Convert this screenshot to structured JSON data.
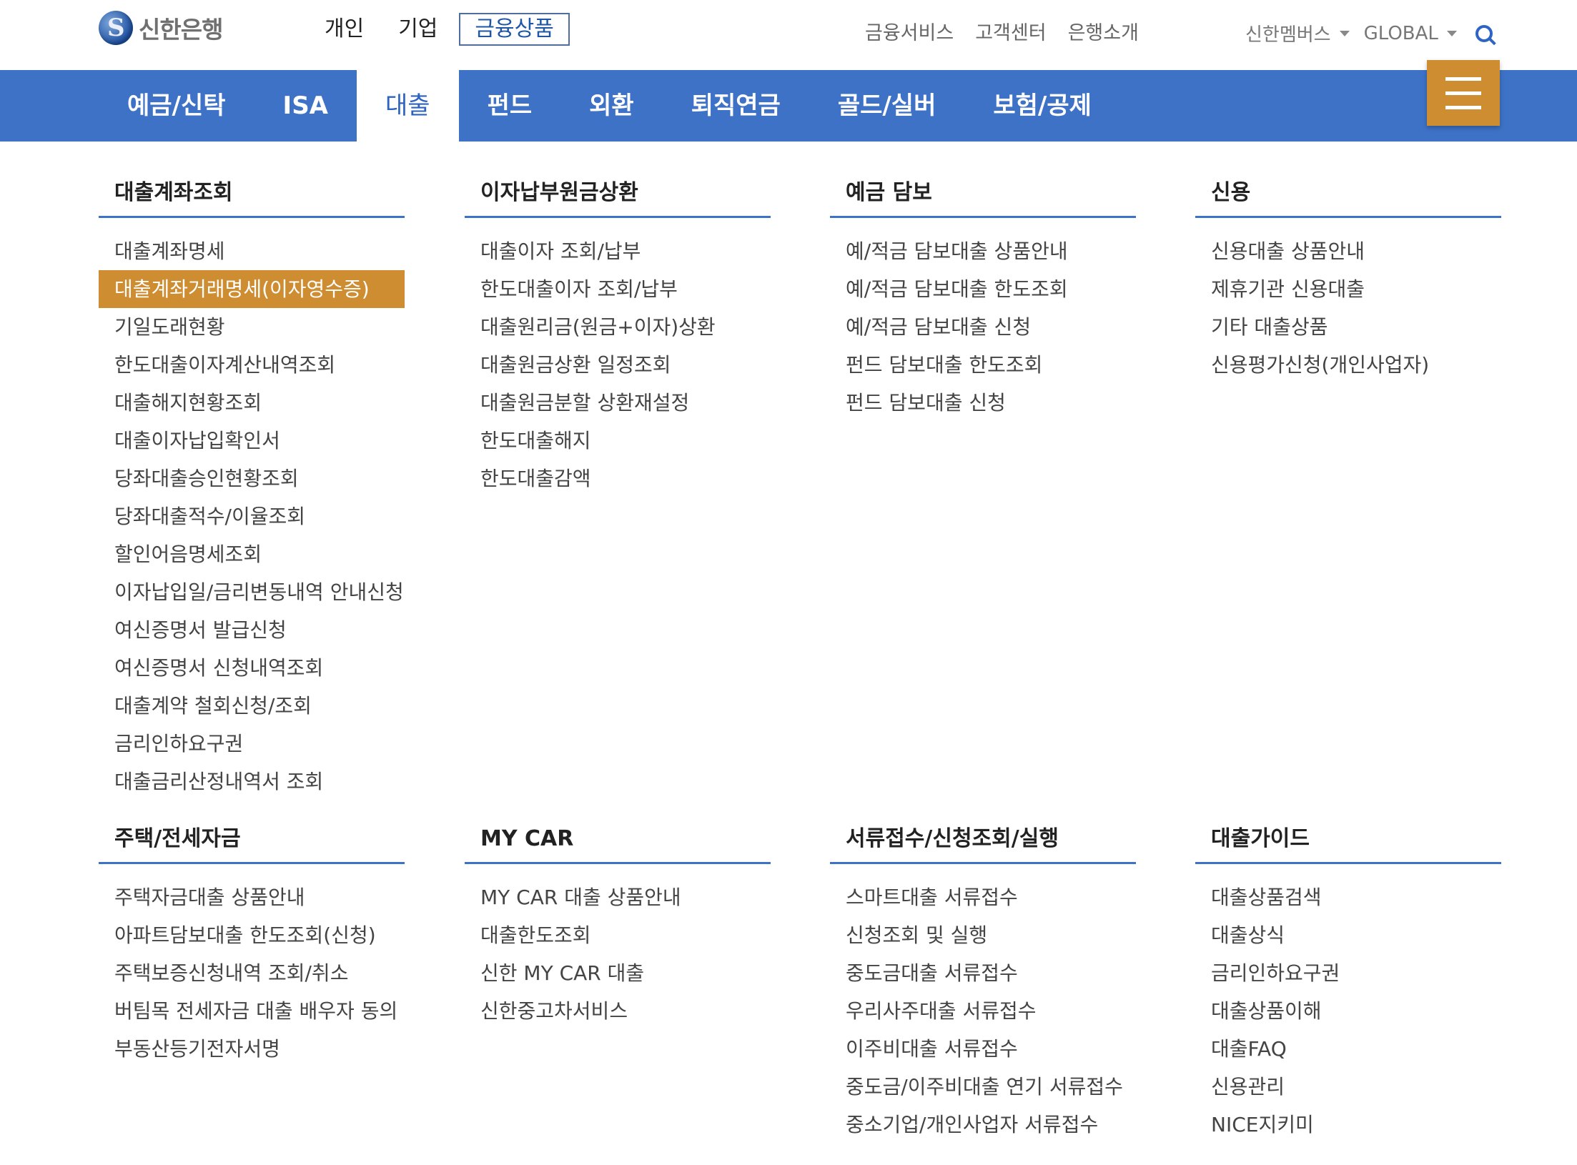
{
  "brand": {
    "name": "신한은행"
  },
  "segments": [
    {
      "label": "개인",
      "active": false
    },
    {
      "label": "기업",
      "active": false
    },
    {
      "label": "금융상품",
      "active": true
    }
  ],
  "utility_links": [
    "금융서비스",
    "고객센터",
    "은행소개"
  ],
  "right_dropdowns": {
    "members": "신한멤버스",
    "global": "GLOBAL"
  },
  "nav": {
    "items": [
      "예금/신탁",
      "ISA",
      "대출",
      "펀드",
      "외환",
      "퇴직연금",
      "골드/실버",
      "보험/공제"
    ],
    "active_index": 2
  },
  "menu": {
    "row1": [
      {
        "title": "대출계좌조회",
        "items": [
          "대출계좌명세",
          "대출계좌거래명세(이자영수증)",
          "기일도래현황",
          "한도대출이자계산내역조회",
          "대출해지현황조회",
          "대출이자납입확인서",
          "당좌대출승인현황조회",
          "당좌대출적수/이율조회",
          "할인어음명세조회",
          "이자납입일/금리변동내역 안내신청",
          "여신증명서 발급신청",
          "여신증명서 신청내역조회",
          "대출계약 철회신청/조회",
          "금리인하요구권",
          "대출금리산정내역서 조회"
        ],
        "highlight_index": 1
      },
      {
        "title": "이자납부원금상환",
        "items": [
          "대출이자 조회/납부",
          "한도대출이자 조회/납부",
          "대출원리금(원금+이자)상환",
          "대출원금상환 일정조회",
          "대출원금분할 상환재설정",
          "한도대출해지",
          "한도대출감액"
        ]
      },
      {
        "title": "예금 담보",
        "items": [
          "예/적금 담보대출 상품안내",
          "예/적금 담보대출 한도조회",
          "예/적금 담보대출 신청",
          "펀드 담보대출 한도조회",
          "펀드 담보대출 신청"
        ]
      },
      {
        "title": "신용",
        "items": [
          "신용대출 상품안내",
          "제휴기관 신용대출",
          "기타 대출상품",
          "신용평가신청(개인사업자)"
        ]
      }
    ],
    "row2": [
      {
        "title": "주택/전세자금",
        "items": [
          "주택자금대출 상품안내",
          "아파트담보대출 한도조회(신청)",
          "주택보증신청내역 조회/취소",
          "버팀목 전세자금 대출 배우자 동의",
          "부동산등기전자서명"
        ]
      },
      {
        "title": "MY CAR",
        "items": [
          "MY CAR 대출 상품안내",
          "대출한도조회",
          "신한 MY CAR 대출",
          "신한중고차서비스"
        ]
      },
      {
        "title": "서류접수/신청조회/실행",
        "items": [
          "스마트대출 서류접수",
          "신청조회 및 실행",
          "중도금대출 서류접수",
          "우리사주대출 서류접수",
          "이주비대출 서류접수",
          "중도금/이주비대출 연기 서류접수",
          "중소기업/개인사업자 서류접수"
        ]
      },
      {
        "title": "대출가이드",
        "items": [
          "대출상품검색",
          "대출상식",
          "금리인하요구권",
          "대출상품이해",
          "대출FAQ",
          "신용관리",
          "NICE지키미"
        ]
      }
    ]
  },
  "colors": {
    "nav_blue": "#3d72c6",
    "accent_orange": "#cf8d32"
  }
}
